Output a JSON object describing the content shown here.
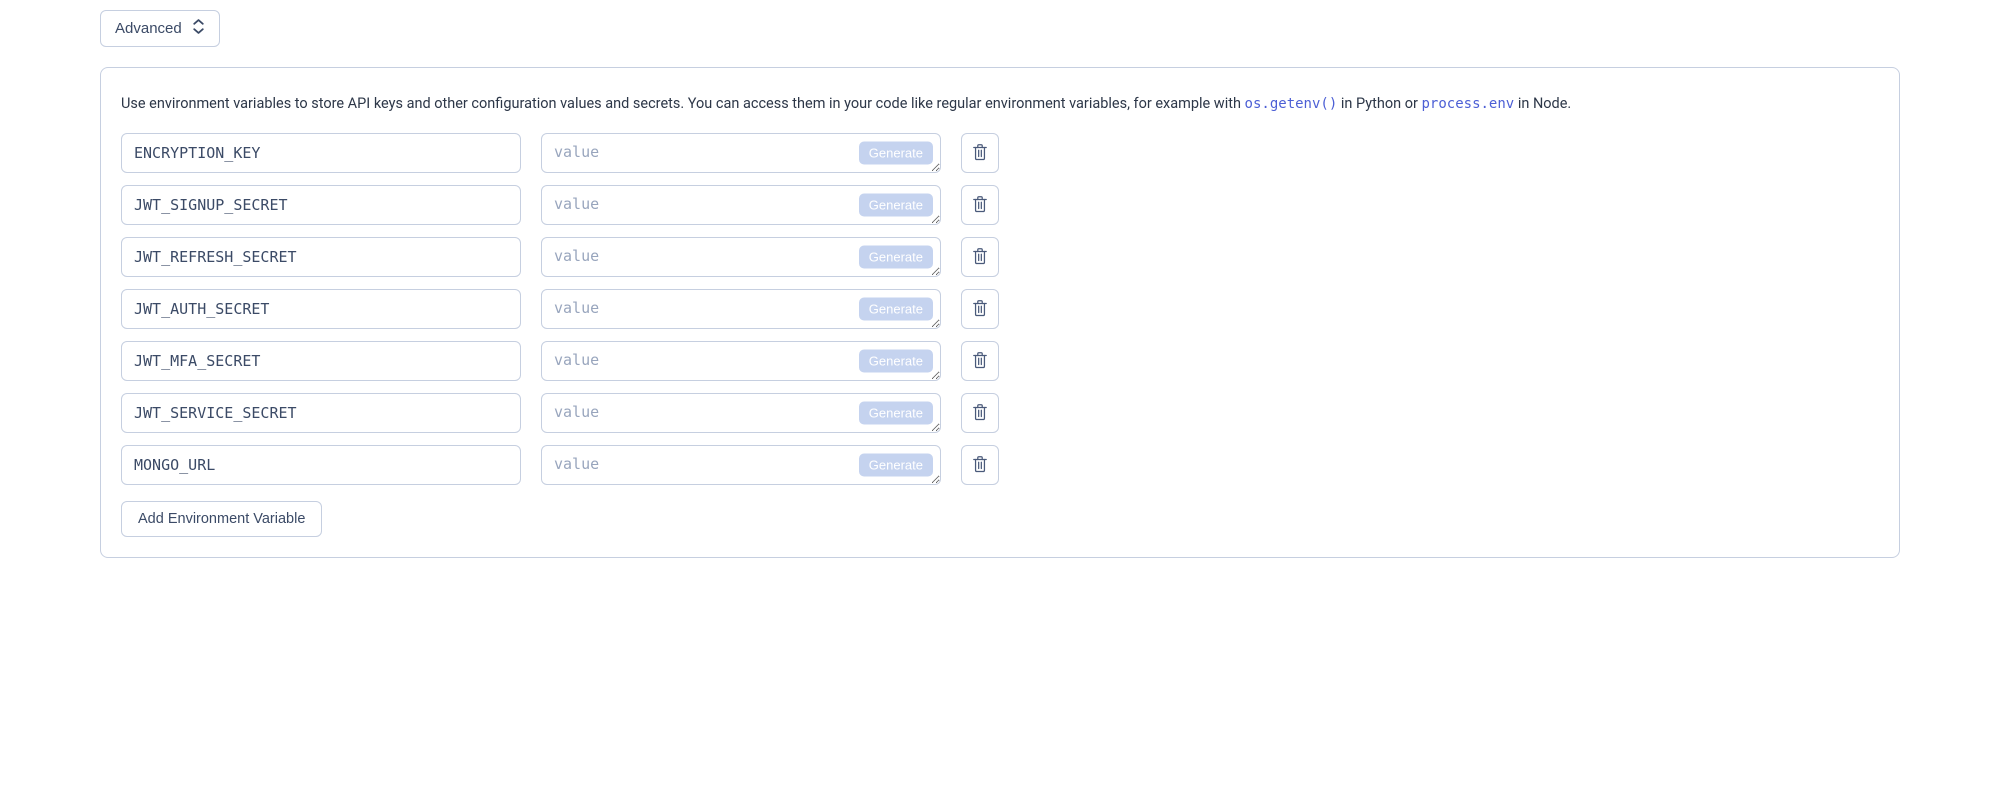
{
  "toggle_label": "Advanced",
  "description": {
    "text_before_code1": "Use environment variables to store API keys and other configuration values and secrets. You can access them in your code like regular environment variables, for example with ",
    "code1": "os.getenv()",
    "text_between": " in Python or ",
    "code2": "process.env",
    "text_after": " in Node."
  },
  "value_placeholder": "value",
  "generate_label": "Generate",
  "add_label": "Add Environment Variable",
  "env_vars": [
    {
      "key": "ENCRYPTION_KEY",
      "value": ""
    },
    {
      "key": "JWT_SIGNUP_SECRET",
      "value": ""
    },
    {
      "key": "JWT_REFRESH_SECRET",
      "value": ""
    },
    {
      "key": "JWT_AUTH_SECRET",
      "value": ""
    },
    {
      "key": "JWT_MFA_SECRET",
      "value": ""
    },
    {
      "key": "JWT_SERVICE_SECRET",
      "value": ""
    },
    {
      "key": "MONGO_URL",
      "value": ""
    }
  ]
}
